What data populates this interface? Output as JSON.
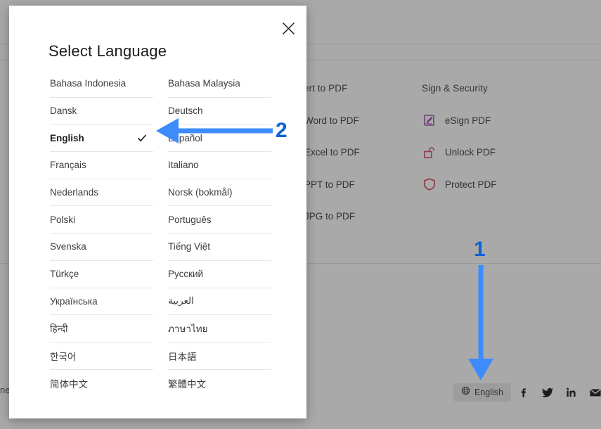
{
  "modal": {
    "title": "Select Language",
    "close_icon": "close-icon",
    "languages": [
      {
        "label": "Bahasa Indonesia",
        "selected": false
      },
      {
        "label": "Bahasa Malaysia",
        "selected": false
      },
      {
        "label": "Dansk",
        "selected": false
      },
      {
        "label": "Deutsch",
        "selected": false
      },
      {
        "label": "English",
        "selected": true
      },
      {
        "label": "Español",
        "selected": false
      },
      {
        "label": "Français",
        "selected": false
      },
      {
        "label": "Italiano",
        "selected": false
      },
      {
        "label": "Nederlands",
        "selected": false
      },
      {
        "label": "Norsk (bokmål)",
        "selected": false
      },
      {
        "label": "Polski",
        "selected": false
      },
      {
        "label": "Português",
        "selected": false
      },
      {
        "label": "Svenska",
        "selected": false
      },
      {
        "label": "Tiếng Việt",
        "selected": false
      },
      {
        "label": "Türkçe",
        "selected": false
      },
      {
        "label": "Русский",
        "selected": false
      },
      {
        "label": "Українська",
        "selected": false
      },
      {
        "label": "العربية",
        "selected": false
      },
      {
        "label": "हिन्दी",
        "selected": false
      },
      {
        "label": "ภาษาไทย",
        "selected": false
      },
      {
        "label": "한국어",
        "selected": false
      },
      {
        "label": "日本語",
        "selected": false
      },
      {
        "label": "简体中文",
        "selected": false
      },
      {
        "label": "繁體中文",
        "selected": false
      }
    ]
  },
  "backdrop": {
    "footer_left_text": "ne",
    "tool_groups": [
      {
        "heading": "Convert to PDF",
        "items": [
          {
            "label": "Word to PDF",
            "icon": "word-to-pdf-icon",
            "color": "#4a9bc4"
          },
          {
            "label": "Excel to PDF",
            "icon": "excel-to-pdf-icon",
            "color": "#4f9e52"
          },
          {
            "label": "PPT to PDF",
            "icon": "ppt-to-pdf-icon",
            "color": "#cf6a36"
          },
          {
            "label": "JPG to PDF",
            "icon": "jpg-to-pdf-icon",
            "color": "#c9a92c"
          }
        ]
      },
      {
        "heading": "Sign & Security",
        "items": [
          {
            "label": "eSign PDF",
            "icon": "esign-pdf-icon",
            "color": "#9b4fb0"
          },
          {
            "label": "Unlock PDF",
            "icon": "unlock-pdf-icon",
            "color": "#d6467e"
          },
          {
            "label": "Protect PDF",
            "icon": "protect-pdf-icon",
            "color": "#d4394a"
          }
        ]
      }
    ],
    "language_switcher": {
      "label": "English",
      "icon": "globe-icon"
    },
    "social": [
      {
        "name": "facebook-icon"
      },
      {
        "name": "twitter-icon"
      },
      {
        "name": "linkedin-icon"
      },
      {
        "name": "email-icon"
      }
    ]
  },
  "annotations": {
    "arrow_color": "#3d8bfd",
    "number_color": "#0b63d6",
    "steps": [
      {
        "number": "1",
        "direction": "down",
        "target": "language-switcher-button"
      },
      {
        "number": "2",
        "direction": "left",
        "target": "english-language-row"
      }
    ]
  }
}
